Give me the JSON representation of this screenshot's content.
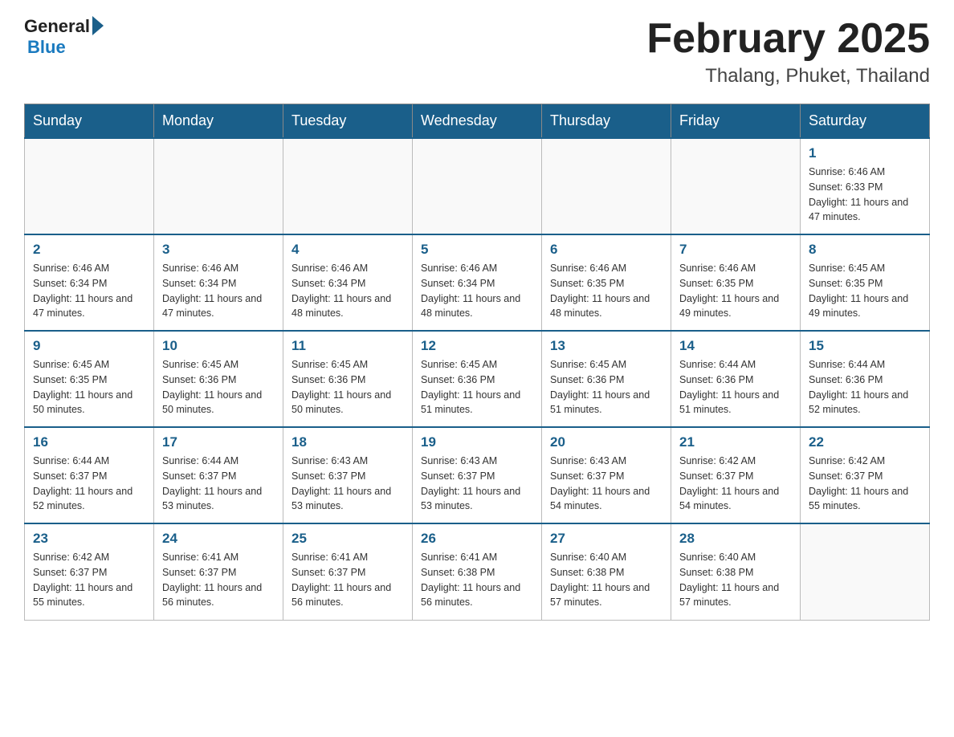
{
  "header": {
    "logo_general": "General",
    "logo_blue": "Blue",
    "month_title": "February 2025",
    "location": "Thalang, Phuket, Thailand"
  },
  "weekdays": [
    "Sunday",
    "Monday",
    "Tuesday",
    "Wednesday",
    "Thursday",
    "Friday",
    "Saturday"
  ],
  "weeks": [
    [
      {
        "day": "",
        "sunrise": "",
        "sunset": "",
        "daylight": ""
      },
      {
        "day": "",
        "sunrise": "",
        "sunset": "",
        "daylight": ""
      },
      {
        "day": "",
        "sunrise": "",
        "sunset": "",
        "daylight": ""
      },
      {
        "day": "",
        "sunrise": "",
        "sunset": "",
        "daylight": ""
      },
      {
        "day": "",
        "sunrise": "",
        "sunset": "",
        "daylight": ""
      },
      {
        "day": "",
        "sunrise": "",
        "sunset": "",
        "daylight": ""
      },
      {
        "day": "1",
        "sunrise": "Sunrise: 6:46 AM",
        "sunset": "Sunset: 6:33 PM",
        "daylight": "Daylight: 11 hours and 47 minutes."
      }
    ],
    [
      {
        "day": "2",
        "sunrise": "Sunrise: 6:46 AM",
        "sunset": "Sunset: 6:34 PM",
        "daylight": "Daylight: 11 hours and 47 minutes."
      },
      {
        "day": "3",
        "sunrise": "Sunrise: 6:46 AM",
        "sunset": "Sunset: 6:34 PM",
        "daylight": "Daylight: 11 hours and 47 minutes."
      },
      {
        "day": "4",
        "sunrise": "Sunrise: 6:46 AM",
        "sunset": "Sunset: 6:34 PM",
        "daylight": "Daylight: 11 hours and 48 minutes."
      },
      {
        "day": "5",
        "sunrise": "Sunrise: 6:46 AM",
        "sunset": "Sunset: 6:34 PM",
        "daylight": "Daylight: 11 hours and 48 minutes."
      },
      {
        "day": "6",
        "sunrise": "Sunrise: 6:46 AM",
        "sunset": "Sunset: 6:35 PM",
        "daylight": "Daylight: 11 hours and 48 minutes."
      },
      {
        "day": "7",
        "sunrise": "Sunrise: 6:46 AM",
        "sunset": "Sunset: 6:35 PM",
        "daylight": "Daylight: 11 hours and 49 minutes."
      },
      {
        "day": "8",
        "sunrise": "Sunrise: 6:45 AM",
        "sunset": "Sunset: 6:35 PM",
        "daylight": "Daylight: 11 hours and 49 minutes."
      }
    ],
    [
      {
        "day": "9",
        "sunrise": "Sunrise: 6:45 AM",
        "sunset": "Sunset: 6:35 PM",
        "daylight": "Daylight: 11 hours and 50 minutes."
      },
      {
        "day": "10",
        "sunrise": "Sunrise: 6:45 AM",
        "sunset": "Sunset: 6:36 PM",
        "daylight": "Daylight: 11 hours and 50 minutes."
      },
      {
        "day": "11",
        "sunrise": "Sunrise: 6:45 AM",
        "sunset": "Sunset: 6:36 PM",
        "daylight": "Daylight: 11 hours and 50 minutes."
      },
      {
        "day": "12",
        "sunrise": "Sunrise: 6:45 AM",
        "sunset": "Sunset: 6:36 PM",
        "daylight": "Daylight: 11 hours and 51 minutes."
      },
      {
        "day": "13",
        "sunrise": "Sunrise: 6:45 AM",
        "sunset": "Sunset: 6:36 PM",
        "daylight": "Daylight: 11 hours and 51 minutes."
      },
      {
        "day": "14",
        "sunrise": "Sunrise: 6:44 AM",
        "sunset": "Sunset: 6:36 PM",
        "daylight": "Daylight: 11 hours and 51 minutes."
      },
      {
        "day": "15",
        "sunrise": "Sunrise: 6:44 AM",
        "sunset": "Sunset: 6:36 PM",
        "daylight": "Daylight: 11 hours and 52 minutes."
      }
    ],
    [
      {
        "day": "16",
        "sunrise": "Sunrise: 6:44 AM",
        "sunset": "Sunset: 6:37 PM",
        "daylight": "Daylight: 11 hours and 52 minutes."
      },
      {
        "day": "17",
        "sunrise": "Sunrise: 6:44 AM",
        "sunset": "Sunset: 6:37 PM",
        "daylight": "Daylight: 11 hours and 53 minutes."
      },
      {
        "day": "18",
        "sunrise": "Sunrise: 6:43 AM",
        "sunset": "Sunset: 6:37 PM",
        "daylight": "Daylight: 11 hours and 53 minutes."
      },
      {
        "day": "19",
        "sunrise": "Sunrise: 6:43 AM",
        "sunset": "Sunset: 6:37 PM",
        "daylight": "Daylight: 11 hours and 53 minutes."
      },
      {
        "day": "20",
        "sunrise": "Sunrise: 6:43 AM",
        "sunset": "Sunset: 6:37 PM",
        "daylight": "Daylight: 11 hours and 54 minutes."
      },
      {
        "day": "21",
        "sunrise": "Sunrise: 6:42 AM",
        "sunset": "Sunset: 6:37 PM",
        "daylight": "Daylight: 11 hours and 54 minutes."
      },
      {
        "day": "22",
        "sunrise": "Sunrise: 6:42 AM",
        "sunset": "Sunset: 6:37 PM",
        "daylight": "Daylight: 11 hours and 55 minutes."
      }
    ],
    [
      {
        "day": "23",
        "sunrise": "Sunrise: 6:42 AM",
        "sunset": "Sunset: 6:37 PM",
        "daylight": "Daylight: 11 hours and 55 minutes."
      },
      {
        "day": "24",
        "sunrise": "Sunrise: 6:41 AM",
        "sunset": "Sunset: 6:37 PM",
        "daylight": "Daylight: 11 hours and 56 minutes."
      },
      {
        "day": "25",
        "sunrise": "Sunrise: 6:41 AM",
        "sunset": "Sunset: 6:37 PM",
        "daylight": "Daylight: 11 hours and 56 minutes."
      },
      {
        "day": "26",
        "sunrise": "Sunrise: 6:41 AM",
        "sunset": "Sunset: 6:38 PM",
        "daylight": "Daylight: 11 hours and 56 minutes."
      },
      {
        "day": "27",
        "sunrise": "Sunrise: 6:40 AM",
        "sunset": "Sunset: 6:38 PM",
        "daylight": "Daylight: 11 hours and 57 minutes."
      },
      {
        "day": "28",
        "sunrise": "Sunrise: 6:40 AM",
        "sunset": "Sunset: 6:38 PM",
        "daylight": "Daylight: 11 hours and 57 minutes."
      },
      {
        "day": "",
        "sunrise": "",
        "sunset": "",
        "daylight": ""
      }
    ]
  ]
}
